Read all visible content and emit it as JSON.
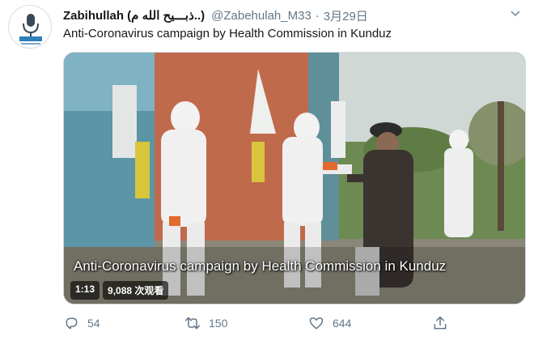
{
  "tweet": {
    "display_name": "Zabihullah (ذبـــیح الله م..)",
    "handle": "@Zabehulah_M33",
    "separator": "·",
    "date": "3月29日",
    "text": "Anti-Coronavirus campaign by Health Commission in Kunduz"
  },
  "media": {
    "caption": "Anti-Coronavirus campaign by Health Commission in Kunduz",
    "duration": "1:13",
    "views": "9,088 次观看"
  },
  "actions": {
    "replies": "54",
    "retweets": "150",
    "likes": "644"
  },
  "icons": {
    "avatar": "microphone-logo-icon",
    "more": "chevron-down-icon",
    "reply": "reply-icon",
    "retweet": "retweet-icon",
    "like": "heart-icon",
    "share": "share-icon"
  },
  "colors": {
    "text": "#14171a",
    "secondary": "#657786"
  }
}
